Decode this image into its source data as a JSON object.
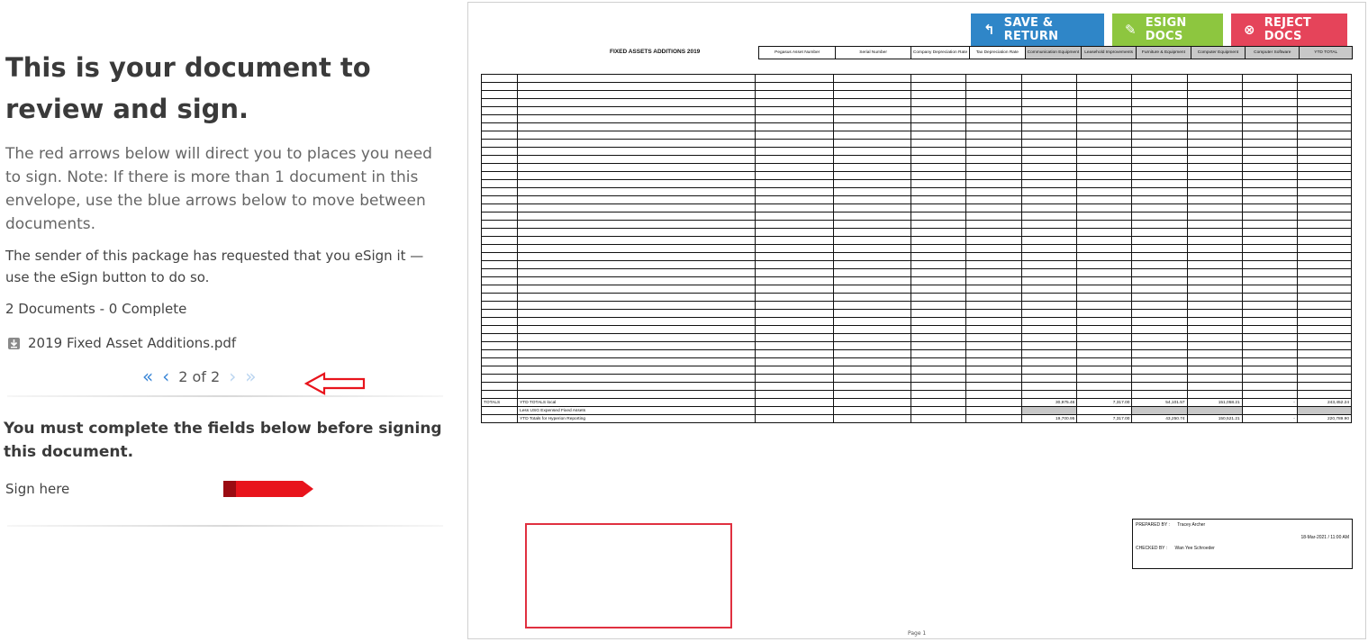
{
  "left_panel": {
    "heading": "This is your document to review and sign.",
    "intro": "The red arrows below will direct you to places you need to sign. Note: If there is more than 1 document in this envelope, use the blue arrows below to move between documents.",
    "sender_note": "The sender of this package has requested that you eSign it — use the eSign button to do so.",
    "doc_count": "2 Documents - 0 Complete",
    "file_name": "2019 Fixed Asset Additions.pdf",
    "pager": {
      "current": "2 of 2"
    },
    "must_complete": "You must complete the fields below before signing this document.",
    "sign_label": "Sign here"
  },
  "toolbar": {
    "save_label": "SAVE & RETURN",
    "esign_label": "ESIGN DOCS",
    "reject_label": "REJECT DOCS"
  },
  "document": {
    "title": "FIXED ASSETS ADDITIONS 2019",
    "headers": [
      "Pegasus Asset Number",
      "Serial Number",
      "Company Depreciation Rate",
      "Tax Depreciation Rate",
      "Communication Equipment",
      "Leasehold Improvements",
      "Furniture & Equipment",
      "Computer Equipment",
      "Computer Software",
      "YTD TOTAL"
    ],
    "totals_label": "TOTALS",
    "ytd_local": "YTD TOTALS local",
    "ytd_totals_values": [
      "30,975.46",
      "7,317.00",
      "54,101.57",
      "151,058.21",
      "-",
      "243,452.24"
    ],
    "less_usg": "Less USG Expensed Fixed Assets",
    "hyperion": "YTD Totals for Hyperion Reporting",
    "hyperion_values": [
      "19,700.95",
      "7,317.00",
      "43,250.74",
      "150,521.21",
      "-",
      "220,789.90"
    ],
    "prepared_by": "PREPARED BY :",
    "prepared_name": "Tracey Archer",
    "prepared_date": "18-Mar-2021 / 11:00 AM",
    "checked_by": "CHECKED BY :",
    "checked_name": "Wan Yee Schroeder",
    "page": "Page 1"
  },
  "colors": {
    "save": "#2f86c8",
    "esign": "#8dc63f",
    "reject": "#e5445a",
    "pager_blue": "#3a86d6",
    "sign_arrow": "#e8141c"
  }
}
